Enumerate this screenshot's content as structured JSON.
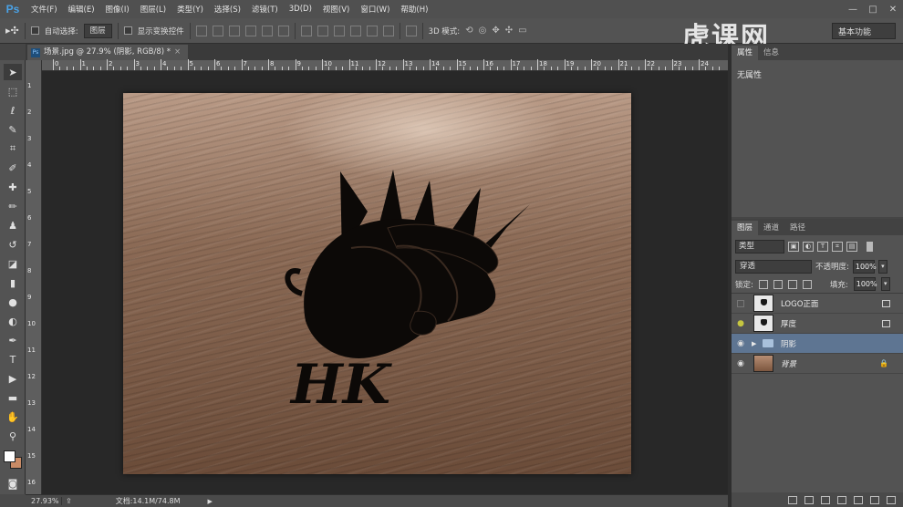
{
  "app": {
    "logo": "Ps",
    "menu": [
      "文件(F)",
      "编辑(E)",
      "图像(I)",
      "图层(L)",
      "类型(Y)",
      "选择(S)",
      "滤镜(T)",
      "3D(D)",
      "视图(V)",
      "窗口(W)",
      "帮助(H)"
    ],
    "window_controls": [
      "—",
      "□",
      "✕"
    ],
    "watermark": "虎课网"
  },
  "options_bar": {
    "auto_select_label": "自动选择:",
    "auto_select_value": "图层",
    "show_transform_label": "显示变换控件",
    "mode_3d_label": "3D 模式:",
    "workspace": "基本功能"
  },
  "document": {
    "tab_title": "场景.jpg @ 27.9% (阴影, RGB/8) *",
    "logo_text": "HK"
  },
  "rulers": {
    "top": [
      "0",
      "1",
      "2",
      "3",
      "4",
      "5",
      "6",
      "7",
      "8",
      "9",
      "10",
      "11",
      "12",
      "13",
      "14",
      "15",
      "16",
      "17",
      "18",
      "19",
      "20",
      "21",
      "22",
      "23",
      "24"
    ],
    "left": [
      "1",
      "2",
      "3",
      "4",
      "5",
      "6",
      "7",
      "8",
      "9",
      "10",
      "11",
      "12",
      "13",
      "14",
      "15",
      "16"
    ]
  },
  "status": {
    "zoom": "27.93%",
    "doc_info": "文档:14.1M/74.8M"
  },
  "properties_panel": {
    "tabs": [
      "属性",
      "信息"
    ],
    "content": "无属性"
  },
  "layers_panel": {
    "tabs": [
      "图层",
      "通道",
      "路径"
    ],
    "filter_kind": "类型",
    "blend_mode": "穿透",
    "opacity_label": "不透明度:",
    "opacity_value": "100%",
    "lock_label": "锁定:",
    "fill_label": "填充:",
    "fill_value": "100%",
    "layers": [
      {
        "name": "LOGO正面",
        "visible": false,
        "selected": false
      },
      {
        "name": "厚度",
        "visible": true,
        "selected": false
      },
      {
        "name": "阴影",
        "visible": true,
        "selected": true
      },
      {
        "name": "背景",
        "visible": true,
        "selected": false
      }
    ]
  },
  "colors": {
    "foreground": "#ffffff",
    "background": "#c98b66",
    "selected_layer": "#5e7592"
  }
}
